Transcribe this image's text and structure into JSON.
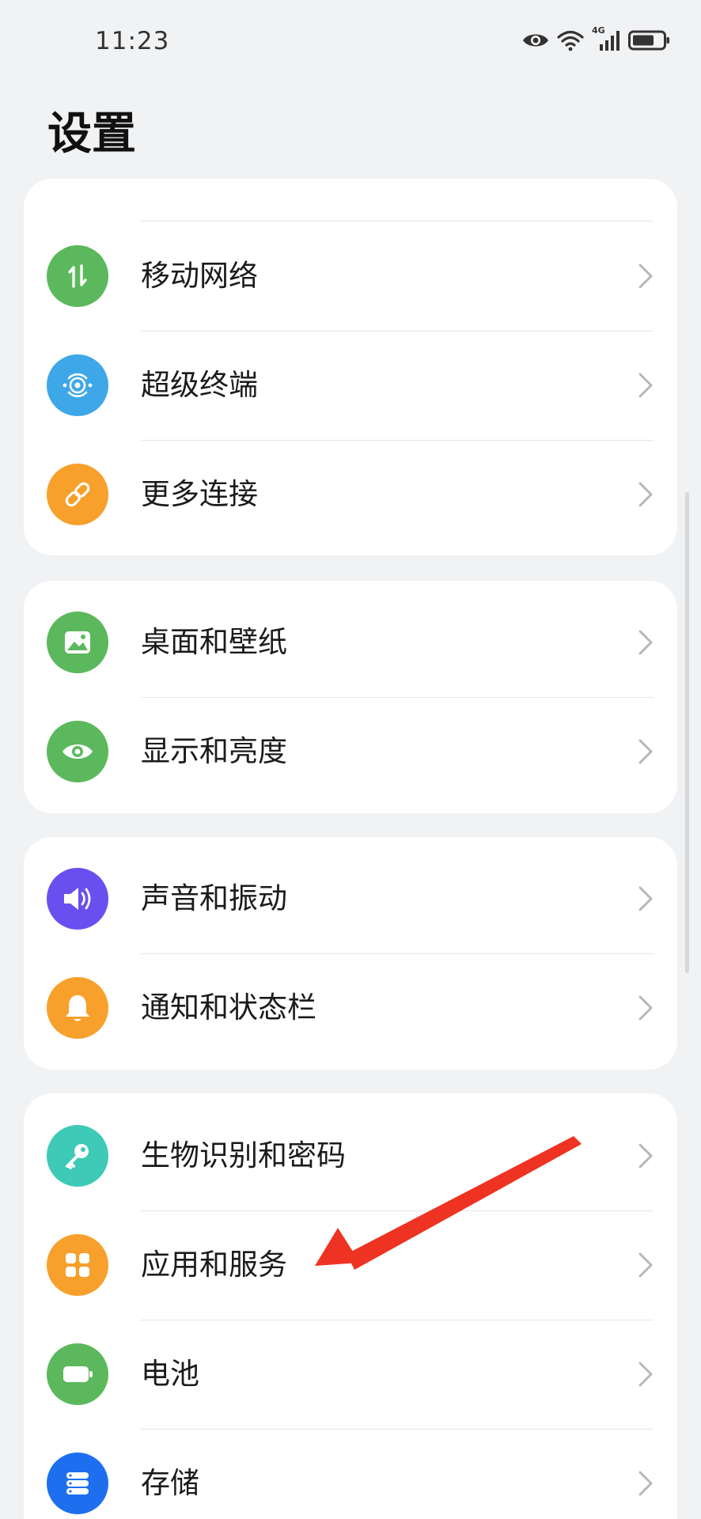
{
  "status_bar": {
    "time": "11:23",
    "network_label": "4G",
    "icons": [
      "eye-icon",
      "wifi-icon",
      "cellular-signal-icon",
      "battery-icon"
    ]
  },
  "page": {
    "title": "设置"
  },
  "sections": [
    {
      "items": [
        {
          "label": "",
          "icon": "bluetooth-icon",
          "color": "#4aaee8",
          "partial": true
        },
        {
          "label": "移动网络",
          "icon": "mobile-data-icon",
          "color": "#5cb85c"
        },
        {
          "label": "超级终端",
          "icon": "super-device-icon",
          "color": "#3ea7e8"
        },
        {
          "label": "更多连接",
          "icon": "link-icon",
          "color": "#f7a02c"
        }
      ]
    },
    {
      "items": [
        {
          "label": "桌面和壁纸",
          "icon": "wallpaper-icon",
          "color": "#5cb85c"
        },
        {
          "label": "显示和亮度",
          "icon": "eye-icon",
          "color": "#5cb85c"
        }
      ]
    },
    {
      "items": [
        {
          "label": "声音和振动",
          "icon": "speaker-icon",
          "color": "#6a4ff0"
        },
        {
          "label": "通知和状态栏",
          "icon": "bell-icon",
          "color": "#f7a02c"
        }
      ]
    },
    {
      "items": [
        {
          "label": "生物识别和密码",
          "icon": "key-icon",
          "color": "#3fc9b7"
        },
        {
          "label": "应用和服务",
          "icon": "apps-icon",
          "color": "#f7a02c"
        },
        {
          "label": "电池",
          "icon": "battery-icon",
          "color": "#5cb85c"
        },
        {
          "label": "存储",
          "icon": "storage-icon",
          "color": "#1e6ff0"
        }
      ]
    }
  ],
  "annotation": {
    "color": "#ee3322",
    "target": "应用和服务"
  }
}
